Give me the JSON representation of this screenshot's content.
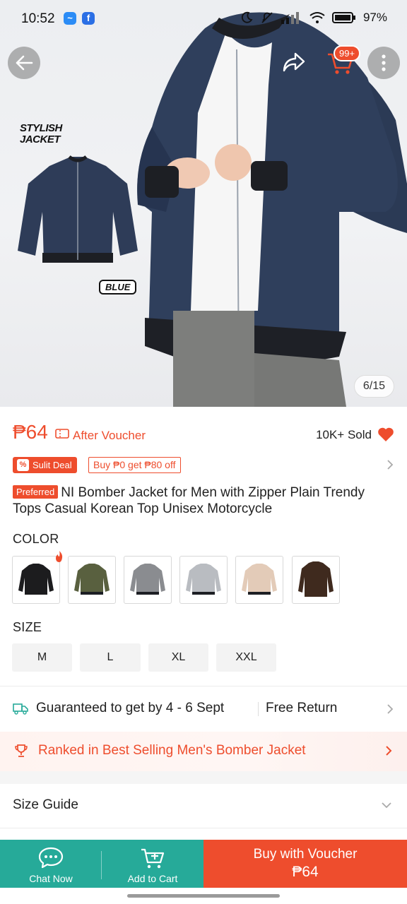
{
  "status_bar": {
    "time": "10:52",
    "battery": "97%",
    "app_icons": [
      "messenger-icon",
      "facebook-icon"
    ],
    "right_icons": [
      "moon-icon",
      "mute-icon",
      "signal-icon",
      "wifi-icon",
      "battery-icon"
    ]
  },
  "header": {
    "cart_badge": "99+",
    "icons": [
      "back-arrow-icon",
      "share-icon",
      "cart-icon",
      "more-icon"
    ]
  },
  "gallery": {
    "overlay_title_line1": "STYLISH",
    "overlay_title_line2": "JACKET",
    "overlay_color_tag": "BLUE",
    "counter": "6/15"
  },
  "product": {
    "price": "₱64",
    "after_voucher": "After Voucher",
    "sold": "10K+ Sold",
    "deal_badge": "Sulit Deal",
    "deal_offer": "Buy ₱0 get ₱80 off",
    "preferred_badge": "Preferred",
    "title": "NI Bomber Jacket for Men with Zipper Plain Trendy Tops Casual Korean Top Unisex Motorcycle",
    "accent_color": "#ee4d2d"
  },
  "variations": {
    "color_label": "COLOR",
    "colors": [
      {
        "name": "Black",
        "hex": "#1c1c1e"
      },
      {
        "name": "Olive",
        "hex": "#59603f"
      },
      {
        "name": "Grey",
        "hex": "#8a8c90"
      },
      {
        "name": "Light Grey",
        "hex": "#b9bcc1"
      },
      {
        "name": "Beige",
        "hex": "#e3cbb8"
      },
      {
        "name": "Brown",
        "hex": "#3f2a1e"
      }
    ],
    "size_label": "SIZE",
    "sizes": [
      "M",
      "L",
      "XL",
      "XXL"
    ]
  },
  "shipping": {
    "guarantee": "Guaranteed to get by 4 - 6 Sept",
    "free_return": "Free Return"
  },
  "ranking": {
    "text": "Ranked in Best Selling Men's Bomber Jacket"
  },
  "size_guide": {
    "label": "Size Guide"
  },
  "bottom_bar": {
    "chat_label": "Chat Now",
    "cart_label": "Add to Cart",
    "buy_label": "Buy with Voucher",
    "buy_price": "₱64",
    "chat_color": "#26aa99",
    "buy_color": "#ee4d2d"
  }
}
